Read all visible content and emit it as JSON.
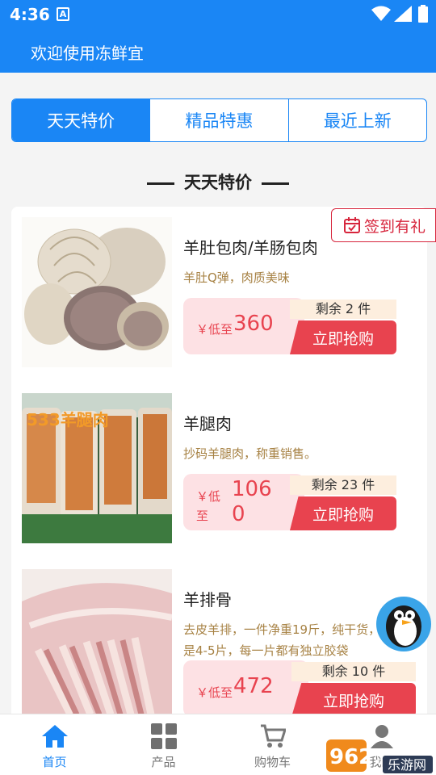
{
  "status": {
    "time": "4:36"
  },
  "header": {
    "title": "欢迎使用冻鲜宜"
  },
  "tabs": [
    {
      "label": "天天特价",
      "active": true
    },
    {
      "label": "精品特惠",
      "active": false
    },
    {
      "label": "最近上新",
      "active": false
    }
  ],
  "section_title": "天天特价",
  "checkin_label": "签到有礼",
  "products": [
    {
      "name": "羊肚包肉/羊肠包肉",
      "desc": "羊肚Q弹，肉质美味",
      "low_label": "￥低至",
      "price": "360",
      "remain": "剩余 2 件",
      "buy": "立即抢购"
    },
    {
      "name": "羊腿肉",
      "desc": "抄码羊腿肉，称重销售。",
      "low_label": "￥低至",
      "price": "1060",
      "remain": "剩余 23 件",
      "buy": "立即抢购",
      "image_text": "533羊腿肉"
    },
    {
      "name": "羊排骨",
      "desc": "去皮羊排，一件净重19斤，纯干货，几乎都是4-5片，每一片都有独立胶袋",
      "low_label": "￥低至",
      "price": "472",
      "remain": "剩余 10 件",
      "buy": "立即抢购"
    }
  ],
  "bottom_nav": [
    {
      "label": "首页",
      "active": true,
      "icon": "home-icon"
    },
    {
      "label": "产品",
      "active": false,
      "icon": "grid-icon"
    },
    {
      "label": "购物车",
      "active": false,
      "icon": "cart-icon"
    },
    {
      "label": "我的",
      "active": false,
      "icon": "user-icon"
    }
  ],
  "watermark": {
    "text1": "962.NET",
    "text2": "乐游网"
  },
  "colors": {
    "primary": "#1a86f5",
    "price_red": "#e8434f",
    "desc_brown": "#a78244"
  }
}
